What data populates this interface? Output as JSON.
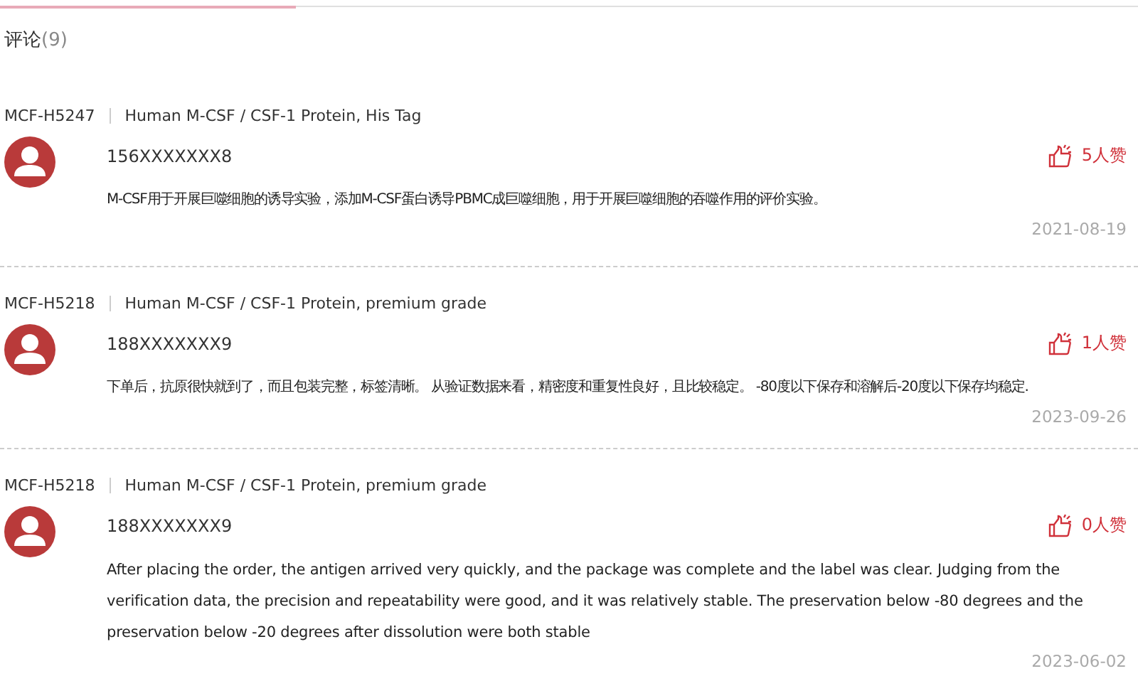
{
  "section": {
    "title": "评论",
    "count": "(9)"
  },
  "comments": [
    {
      "sku": "MCF-H5247",
      "product": "Human M-CSF / CSF-1 Protein, His Tag",
      "user": "156XXXXXXX8",
      "likes": "5人赞",
      "text": "M-CSF用于开展巨噬细胞的诱导实验，添加M-CSF蛋白诱导PBMC成巨噬细胞，用于开展巨噬细胞的吞噬作用的评价实验。",
      "date": "2021-08-19"
    },
    {
      "sku": "MCF-H5218",
      "product": "Human M-CSF / CSF-1 Protein, premium grade",
      "user": "188XXXXXXX9",
      "likes": "1人赞",
      "text": "下单后，抗原很快就到了，而且包装完整，标签清晰。 从验证数据来看，精密度和重复性良好，且比较稳定。 -80度以下保存和溶解后-20度以下保存均稳定.",
      "date": "2023-09-26"
    },
    {
      "sku": "MCF-H5218",
      "product": "Human M-CSF / CSF-1 Protein, premium grade",
      "user": "188XXXXXXX9",
      "likes": "0人赞",
      "text": "After placing the order, the antigen arrived very quickly, and the package was complete and the label was clear. Judging from the verification data, the precision and repeatability were good, and it was relatively stable. The preservation below -80 degrees and the preservation below -20 degrees after dissolution were both stable",
      "date": "2023-06-02"
    }
  ]
}
